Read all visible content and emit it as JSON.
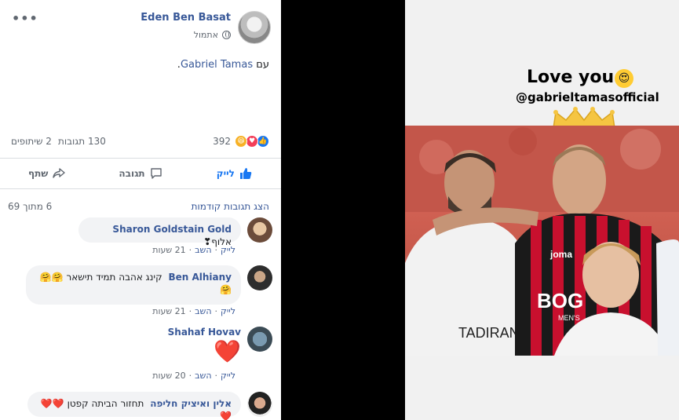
{
  "post": {
    "author": "Eden Ben Basat",
    "time": "אתמול",
    "with_prefix": "עם",
    "tagged": "Gabriel Tamas",
    "tagged_suffix": ".",
    "reaction_count": "392",
    "comments_count": "130 תגובות",
    "shares_count": "2 שיתופים",
    "actions": {
      "like": "לייק",
      "comment": "תגובה",
      "share": "שתף"
    }
  },
  "comments_section": {
    "previous_link": "הצג תגובות קודמות",
    "page_count": "6 מתוך 69"
  },
  "comments": [
    {
      "name": "Sharon Goldstain Gold",
      "text": "אלוף❣",
      "like": "לייק",
      "reply": "השב",
      "time": "21 שעות"
    },
    {
      "name": "Ben Alhiany",
      "text": "קינג אהבה תמיד תישאר 🤗🤗🤗",
      "like": "לייק",
      "reply": "השב",
      "time": "21 שעות"
    },
    {
      "name": "Shahaf Hovav",
      "text": "❤️",
      "like": "לייק",
      "reply": "השב",
      "time": "20 שעות"
    },
    {
      "name": "אלין ואיציק חליפה",
      "text": "תחזור הביתה קפטן ❤️❤️❤️",
      "like": "",
      "reply": "",
      "time": ""
    }
  ],
  "story": {
    "headline": "Love you",
    "emoji": "😍",
    "handle": "@gabrieltamasofficial",
    "jersey_brand": "joma",
    "sponsor_left": "TADIRAN",
    "sponsor_right": "BOG",
    "sponsor_sub": "MEN'S"
  },
  "colors": {
    "link": "#385898",
    "like_blue": "#1877f2",
    "bg_gray": "#f2f3f5",
    "jersey_red": "#c8102e"
  }
}
